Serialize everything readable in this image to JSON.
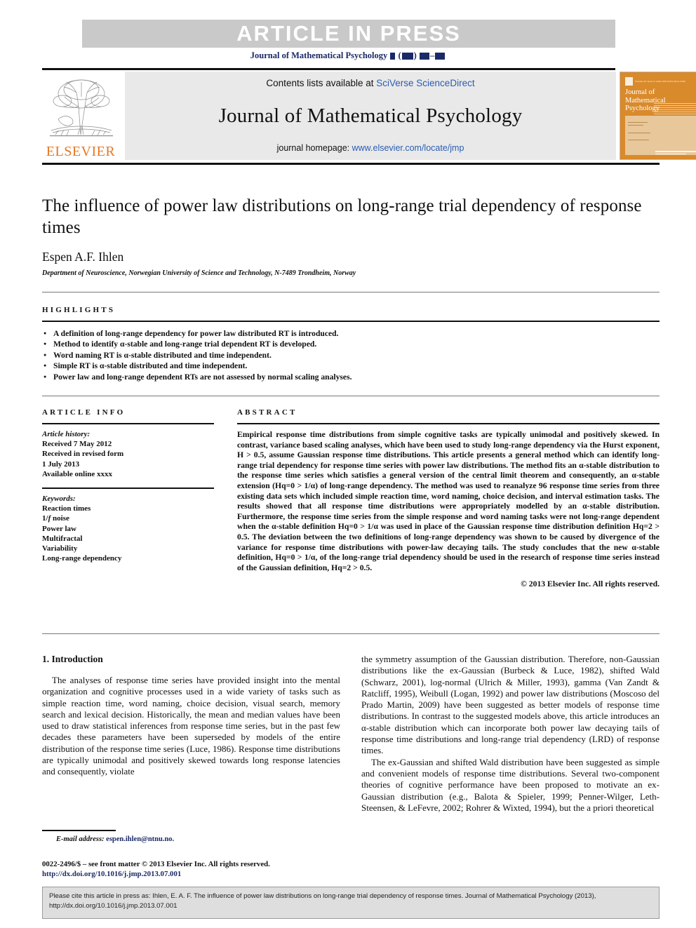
{
  "banner": {
    "article_in_press": "ARTICLE  IN  PRESS",
    "journal_running_head": "Journal of Mathematical Psychology"
  },
  "masthead": {
    "publisher": "ELSEVIER",
    "contents_prefix": "Contents lists available at ",
    "contents_link": "SciVerse ScienceDirect",
    "journal_title": "Journal of Mathematical Psychology",
    "homepage_prefix": "journal homepage: ",
    "homepage_link": "www.elsevier.com/locate/jmp",
    "cover": {
      "line1": "Journal of",
      "line2": "Mathematical",
      "line3": "Psychology",
      "top_bar": "Volume 00  Issue 0  Index 000  ISSN 0022-2496"
    }
  },
  "article": {
    "title": "The influence of power law distributions on long-range trial dependency of response times",
    "author": "Espen A.F. Ihlen",
    "affiliation": "Department of Neuroscience, Norwegian University of Science and Technology, N-7489 Trondheim, Norway"
  },
  "highlights": {
    "heading": "HIGHLIGHTS",
    "items": [
      "A definition of long-range dependency for power law distributed RT is introduced.",
      "Method to identify α-stable and long-range trial dependent RT is developed.",
      "Word naming RT is α-stable distributed and time independent.",
      "Simple RT is α-stable distributed and time independent.",
      "Power law and long-range dependent RTs are not assessed by normal scaling analyses."
    ]
  },
  "article_info": {
    "heading": "ARTICLE INFO",
    "history_label": "Article history:",
    "history": [
      "Received 7 May 2012",
      "Received in revised form",
      "1 July 2013",
      "Available online xxxx"
    ],
    "keywords_label": "Keywords:",
    "keywords": [
      "Reaction times",
      "1/f noise",
      "Power law",
      "Multifractal",
      "Variability",
      "Long-range dependency"
    ]
  },
  "abstract": {
    "heading": "ABSTRACT",
    "text": "Empirical response time distributions from simple cognitive tasks are typically unimodal and positively skewed. In contrast, variance based scaling analyses, which have been used to study long-range dependency via the Hurst exponent, H > 0.5, assume Gaussian response time distributions. This article presents a general method which can identify long-range trial dependency for response time series with power law distributions. The method fits an α-stable distribution to the response time series which satisfies a general version of the central limit theorem and consequently, an α-stable extension (Hq=0 > 1/α) of long-range dependency. The method was used to reanalyze 96 response time series from three existing data sets which included simple reaction time, word naming, choice decision, and interval estimation tasks. The results showed that all response time distributions were appropriately modelled by an α-stable distribution. Furthermore, the response time series from the simple response and word naming tasks were not long-range dependent when the α-stable definition Hq=0 > 1/α was used in place of the Gaussian response time distribution definition Hq=2 > 0.5. The deviation between the two definitions of long-range dependency was shown to be caused by divergence of the variance for response time distributions with power-law decaying tails. The study concludes that the new α-stable definition, Hq=0 > 1/α, of the long-range trial dependency should be used in the research of response time series instead of the Gaussian definition, Hq=2 > 0.5.",
    "copyright": "© 2013 Elsevier Inc. All rights reserved."
  },
  "introduction": {
    "heading": "1. Introduction",
    "left_paragraph_1": "The analyses of response time series have provided insight into the mental organization and cognitive processes used in a wide variety of tasks such as simple reaction time, word naming, choice decision, visual search, memory search and lexical decision. Historically, the mean and median values have been used to draw statistical inferences from response time series, but in the past few decades these parameters have been superseded by models of the entire distribution of the response time series (Luce, 1986). Response time distributions are typically unimodal and positively skewed towards long response latencies and consequently, violate",
    "right_paragraph_1": "the symmetry assumption of the Gaussian distribution. Therefore, non-Gaussian distributions like the ex-Gaussian (Burbeck & Luce, 1982), shifted Wald (Schwarz, 2001), log-normal (Ulrich & Miller, 1993), gamma (Van Zandt & Ratcliff, 1995), Weibull (Logan, 1992) and power law distributions (Moscoso del Prado Martin, 2009) have been suggested as better models of response time distributions. In contrast to the suggested models above, this article introduces an α-stable distribution which can incorporate both power law decaying tails of response time distributions and long-range trial dependency (LRD) of response times.",
    "right_paragraph_2": "The ex-Gaussian and shifted Wald distribution have been suggested as simple and convenient models of response time distributions. Several two-component theories of cognitive performance have been proposed to motivate an ex-Gaussian distribution (e.g., Balota & Spieler, 1999; Penner-Wilger, Leth-Steensen, & LeFevre, 2002; Rohrer & Wixted, 1994), but the a priori theoretical"
  },
  "footer": {
    "email_label": "E-mail address:",
    "email": "espen.ihlen@ntnu.no.",
    "issn_line": "0022-2496/$ – see front matter © 2013 Elsevier Inc. All rights reserved.",
    "doi": "http://dx.doi.org/10.1016/j.jmp.2013.07.001"
  },
  "cite_box": {
    "text": "Please cite this article in press as: Ihlen, E. A. F. The influence of power law distributions on long-range trial dependency of response times. Journal of Mathematical Psychology (2013), http://dx.doi.org/10.1016/j.jmp.2013.07.001"
  },
  "colors": {
    "link": "#2a5db0",
    "reference": "#1b2a66",
    "elsevier_orange": "#E87722",
    "cover_orange": "#D98A2B",
    "banner_gray": "#c9c9c9"
  }
}
